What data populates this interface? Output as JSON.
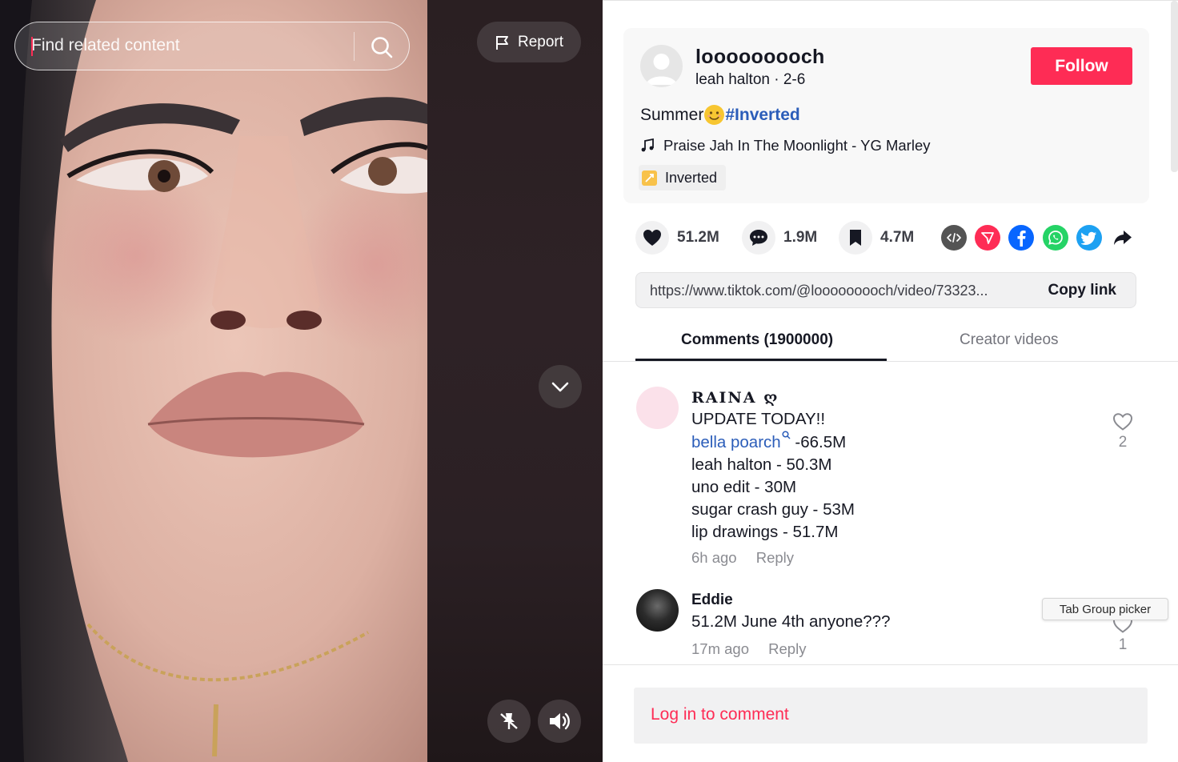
{
  "search": {
    "placeholder": "Find related content"
  },
  "video": {
    "report_label": "Report"
  },
  "post": {
    "username": "looooooooch",
    "display_name": "leah halton",
    "date": "2-6",
    "follow_label": "Follow",
    "caption_text": "Summer",
    "hashtag": "#Inverted",
    "music": "Praise Jah In The Moonlight - YG Marley",
    "effect": "Inverted"
  },
  "stats": {
    "likes": "51.2M",
    "comments": "1.9M",
    "saves": "4.7M"
  },
  "share_icons": [
    "embed-icon",
    "send-icon",
    "facebook-icon",
    "whatsapp-icon",
    "twitter-icon",
    "share-arrow-icon"
  ],
  "colors": {
    "accent": "#fe2c55",
    "link": "#2b5db9",
    "facebook": "#0866ff",
    "whatsapp": "#25d366",
    "twitter": "#1da1f2",
    "embed": "#545454"
  },
  "link": {
    "url": "https://www.tiktok.com/@looooooooch/video/73323...",
    "copy_label": "Copy link"
  },
  "tabs": {
    "comments": "Comments (1900000)",
    "creator": "Creator videos"
  },
  "comments": [
    {
      "name": "𝐑𝐀𝐈𝐍𝐀 ღ",
      "lines": [
        "UPDATE TODAY!!",
        "-66.5M",
        "leah halton - 50.3M",
        "uno edit - 30M",
        "sugar crash guy - 53M",
        "lip drawings - 51.7M"
      ],
      "mention": "bella poarch",
      "time": "6h ago",
      "reply": "Reply",
      "likes": "2"
    },
    {
      "name": "Eddie",
      "lines": [
        "51.2M June 4th anyone???"
      ],
      "time": "17m ago",
      "reply": "Reply",
      "likes": "1"
    }
  ],
  "tooltip": "Tab Group picker",
  "login": "Log in to comment"
}
